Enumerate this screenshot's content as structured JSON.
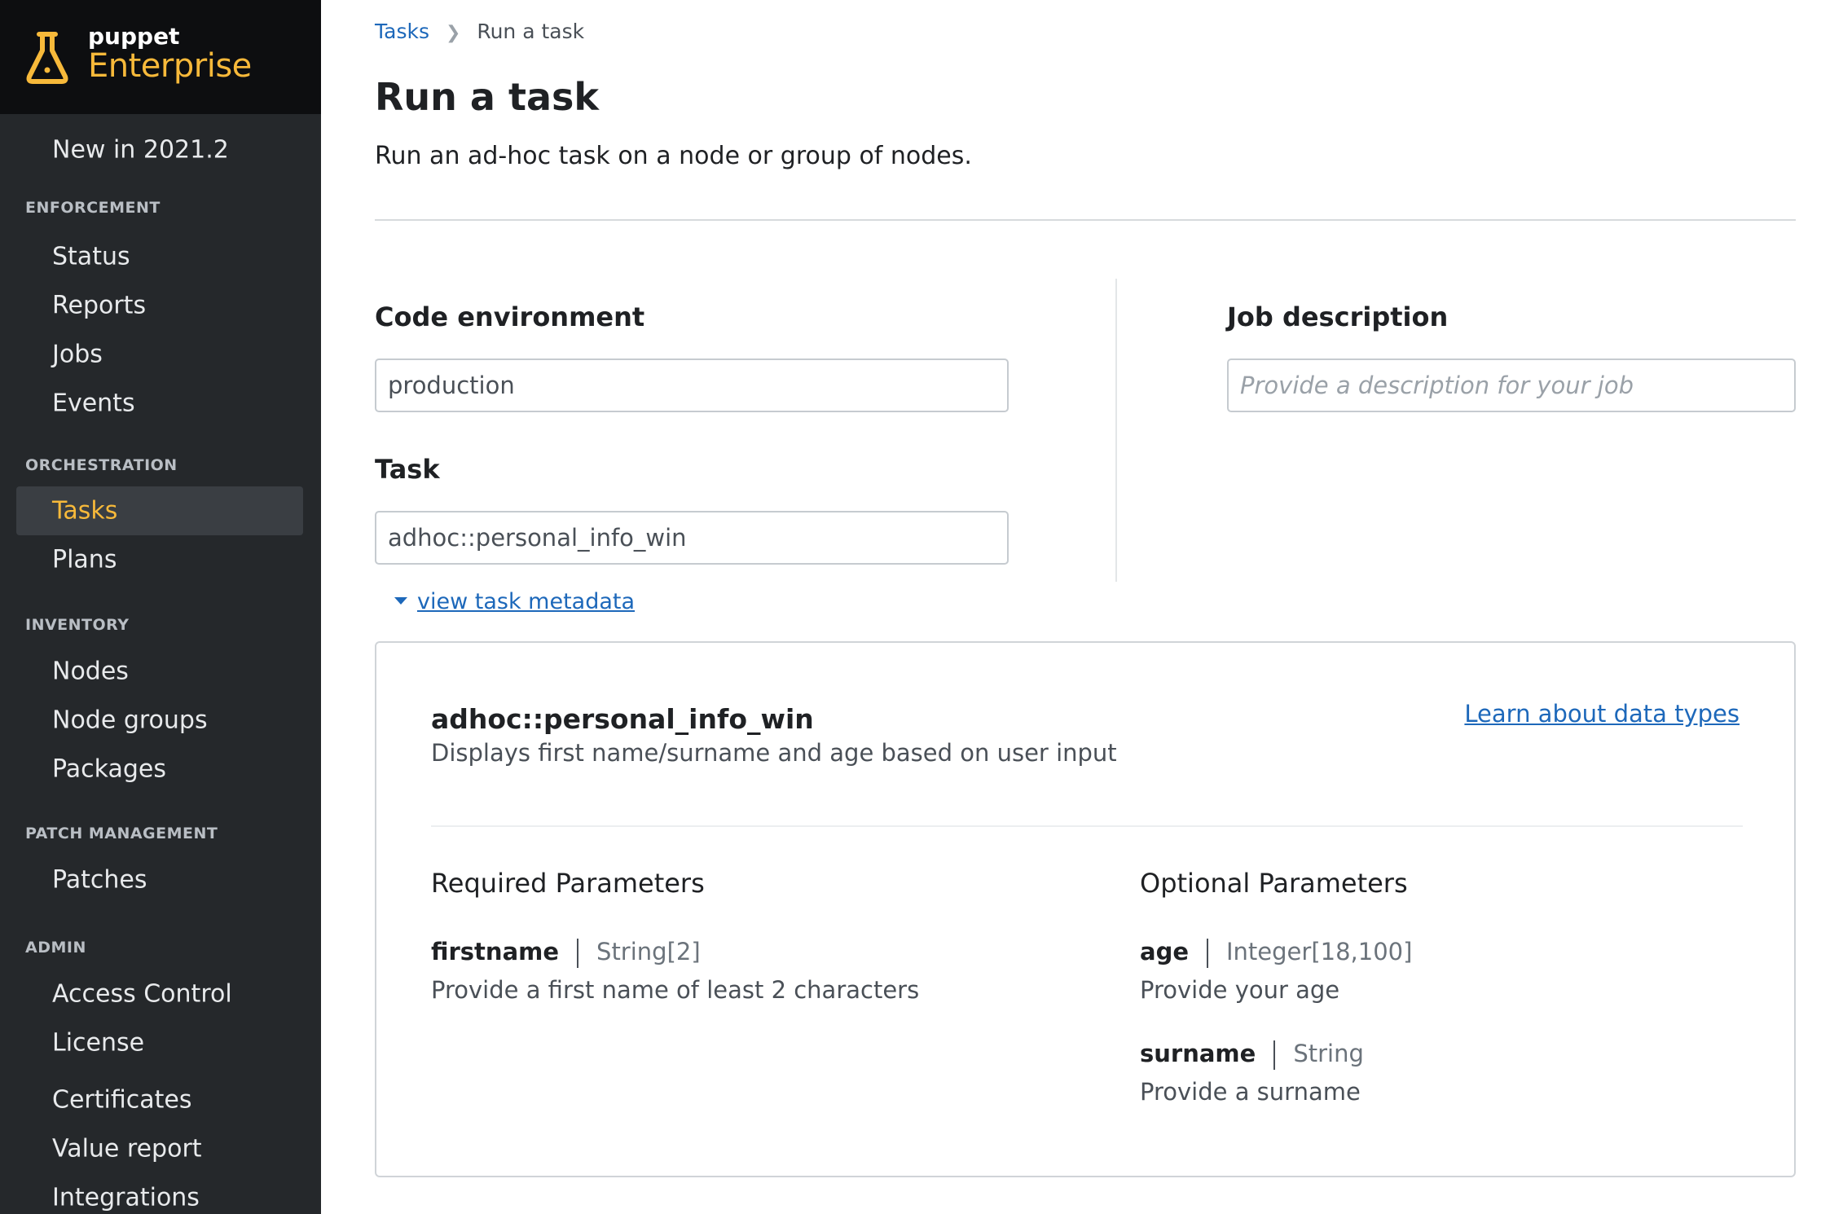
{
  "brand": {
    "company": "puppet",
    "product": "Enterprise",
    "logo_icon": "flask-icon"
  },
  "sidebar": {
    "top_item": "New in 2021.2",
    "sections": [
      {
        "title": "ENFORCEMENT",
        "items": [
          "Status",
          "Reports",
          "Jobs",
          "Events"
        ]
      },
      {
        "title": "ORCHESTRATION",
        "items": [
          "Tasks",
          "Plans"
        ]
      },
      {
        "title": "INVENTORY",
        "items": [
          "Nodes",
          "Node groups",
          "Packages"
        ]
      },
      {
        "title": "PATCH MANAGEMENT",
        "items": [
          "Patches"
        ]
      },
      {
        "title": "ADMIN",
        "items": [
          "Access Control",
          "License",
          "Certificates",
          "Value report",
          "Integrations"
        ]
      }
    ],
    "active_item": "Tasks"
  },
  "breadcrumb": {
    "parent": "Tasks",
    "current": "Run a task",
    "separator_icon": "chevron-right-icon"
  },
  "page": {
    "title": "Run a task",
    "subtitle": "Run an ad-hoc task on a node or group of nodes."
  },
  "form": {
    "code_environment": {
      "label": "Code environment",
      "value": "production"
    },
    "task": {
      "label": "Task",
      "value": "adhoc::personal_info_win"
    },
    "job_description": {
      "label": "Job description",
      "placeholder": "Provide a description for your job",
      "value": ""
    },
    "metadata_toggle": "view task metadata"
  },
  "metadata": {
    "name": "adhoc::personal_info_win",
    "description": "Displays first name/surname and age based on user input",
    "learn_link": "Learn about data types",
    "required_heading": "Required Parameters",
    "optional_heading": "Optional Parameters",
    "required": [
      {
        "name": "firstname",
        "type": "String[2]",
        "description": "Provide a first name of least 2 characters"
      }
    ],
    "optional": [
      {
        "name": "age",
        "type": "Integer[18,100]",
        "description": "Provide your age"
      },
      {
        "name": "surname",
        "type": "String",
        "description": "Provide a surname"
      }
    ]
  },
  "colors": {
    "sidebar_bg": "#25282b",
    "brand_bg": "#0d0e10",
    "accent": "#f7b93a",
    "link": "#1d68ba"
  }
}
